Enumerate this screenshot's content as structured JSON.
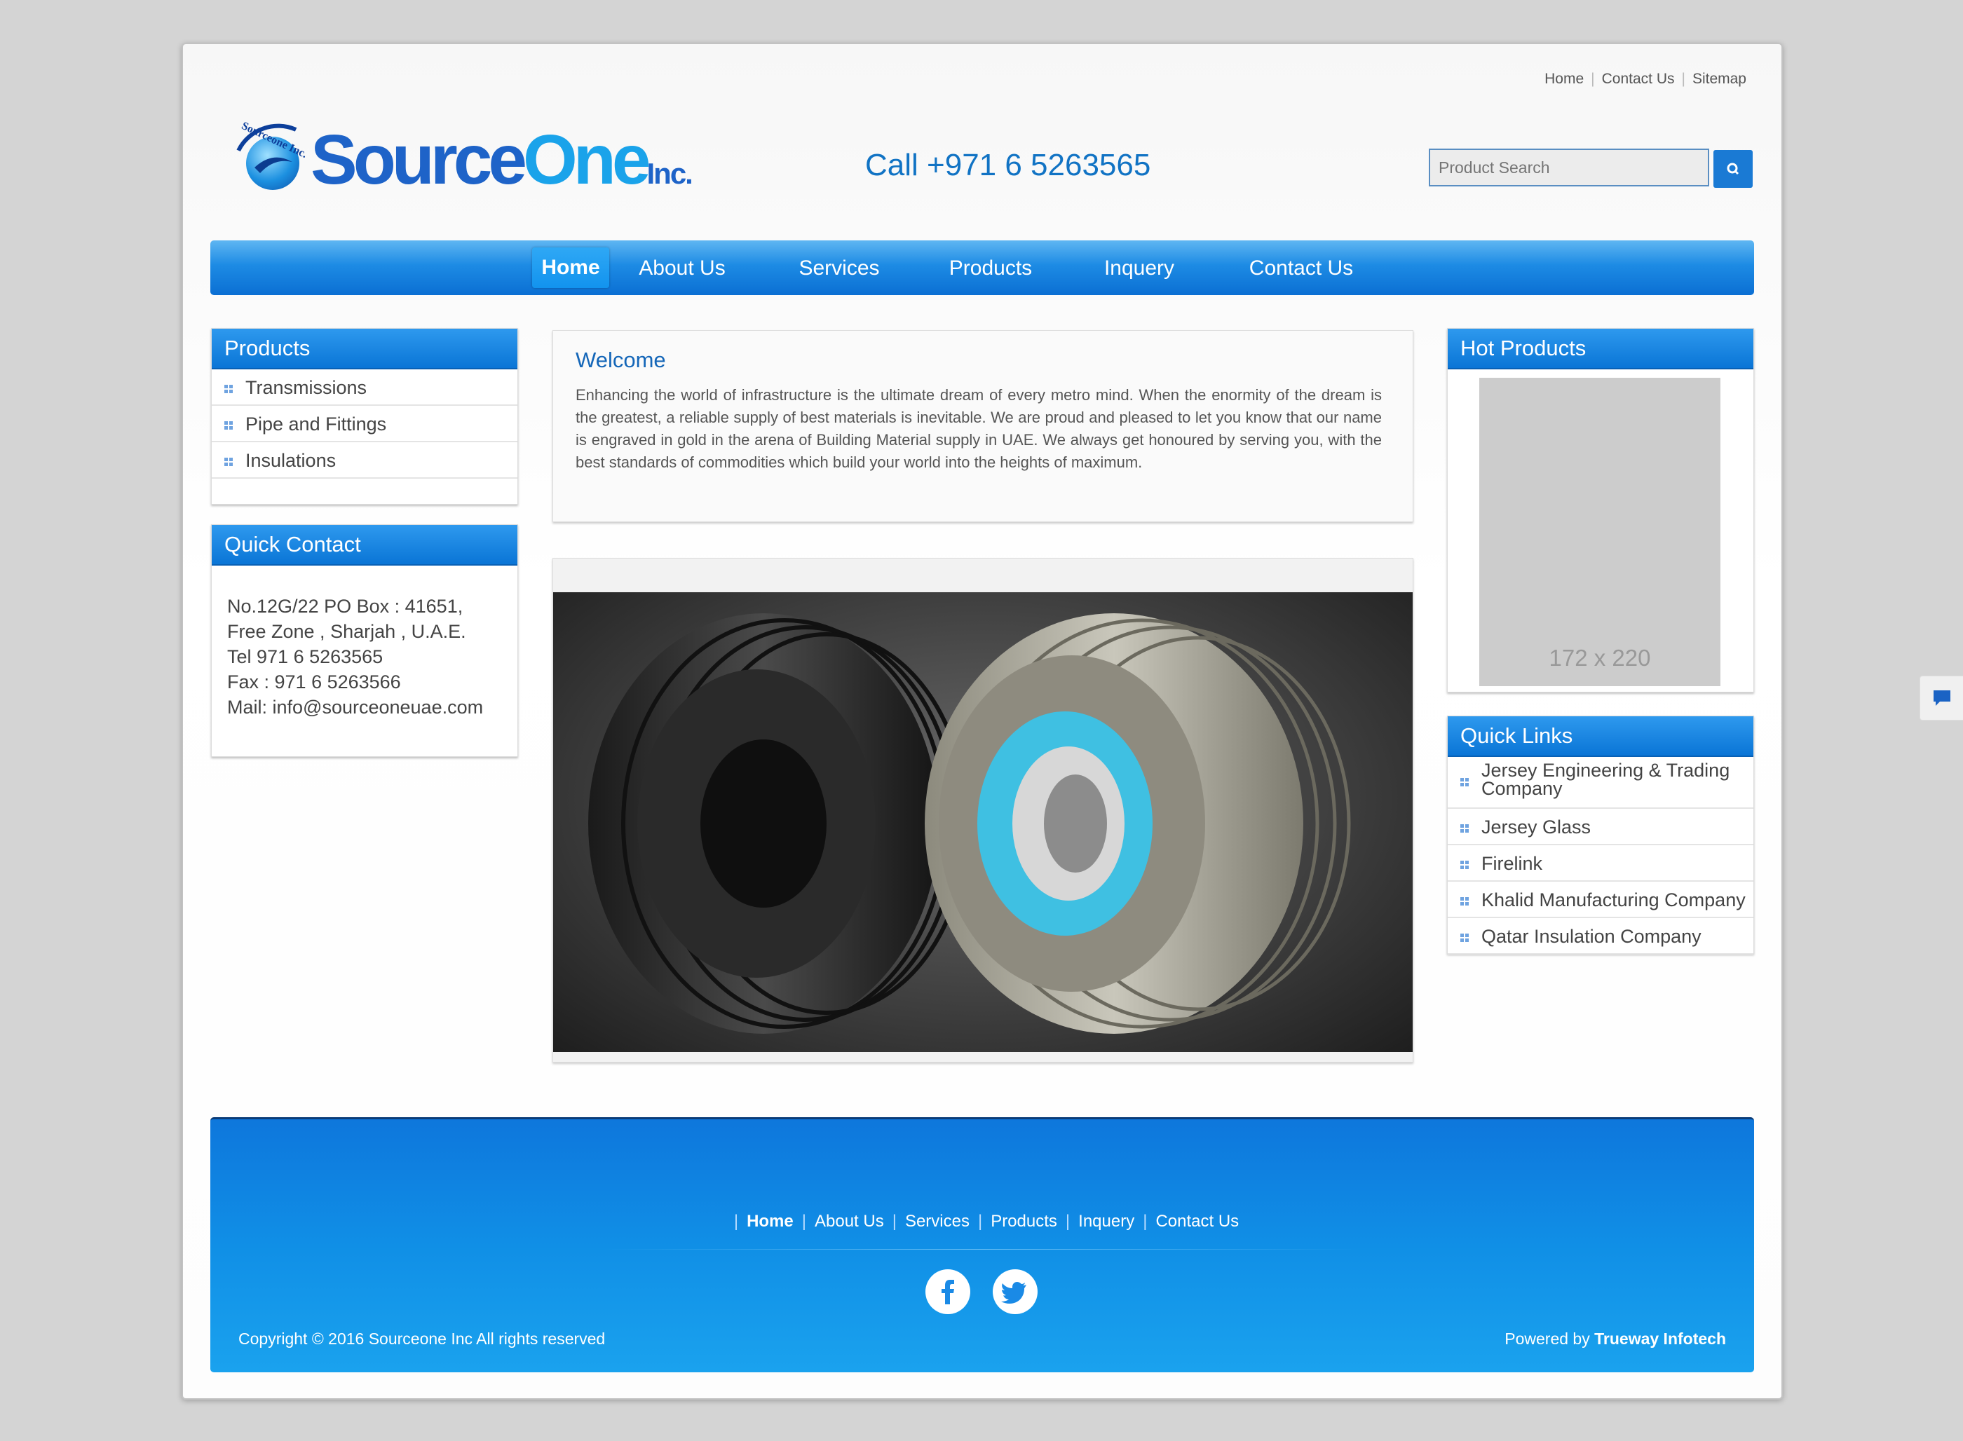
{
  "top_links": [
    "Home",
    "Contact Us",
    "Sitemap"
  ],
  "logo": {
    "text_main": "Source",
    "text_accent": "One",
    "text_suffix": "Inc.",
    "arc_text": "Sourceone Inc."
  },
  "phone": "Call +971 6 5263565",
  "search": {
    "placeholder": "Product Search"
  },
  "nav": {
    "items": [
      "Home",
      "About Us",
      "Services",
      "Products",
      "Inquery",
      "Contact Us"
    ],
    "active": "Home"
  },
  "products_box": {
    "title": "Products",
    "items": [
      "Transmissions",
      "Pipe and Fittings",
      "Insulations"
    ]
  },
  "quick_contact": {
    "title": "Quick Contact",
    "lines": [
      "No.12G/22 PO Box : 41651,",
      "Free Zone , Sharjah , U.A.E.",
      "Tel 971 6 5263565",
      "Fax : 971 6 5263566",
      "Mail: info@sourceoneuae.com"
    ]
  },
  "welcome": {
    "title": "Welcome",
    "body": "Enhancing the world of infrastructure is the ultimate dream of every metro mind. When the enormity of the dream is the greatest, a reliable supply of best materials is inevitable. We are proud and pleased to let you know that our name is engraved in gold in the arena of Building Material supply in UAE. We always get honoured by serving you, with the best standards of commodities which build your world into the heights of maximum."
  },
  "hot_products": {
    "title": "Hot Products",
    "placeholder": "172 x 220"
  },
  "quick_links": {
    "title": "Quick Links",
    "items": [
      "Jersey Engineering & Trading Company",
      "Jersey Glass",
      "Firelink",
      "Khalid Manufacturing Company",
      "Qatar Insulation Company"
    ]
  },
  "footer": {
    "links": [
      "Home",
      "About Us",
      "Services",
      "Products",
      "Inquery",
      "Contact Us"
    ],
    "copyright": "Copyright © 2016 Sourceone Inc All rights reserved",
    "powered_prefix": "Powered by",
    "powered_by": "Trueway Infotech",
    "social": [
      "facebook-icon",
      "twitter-icon"
    ]
  },
  "colors": {
    "brand_blue": "#1173c4",
    "nav_blue": "#0b6fd3",
    "accent_cyan": "#1aa3ea"
  }
}
